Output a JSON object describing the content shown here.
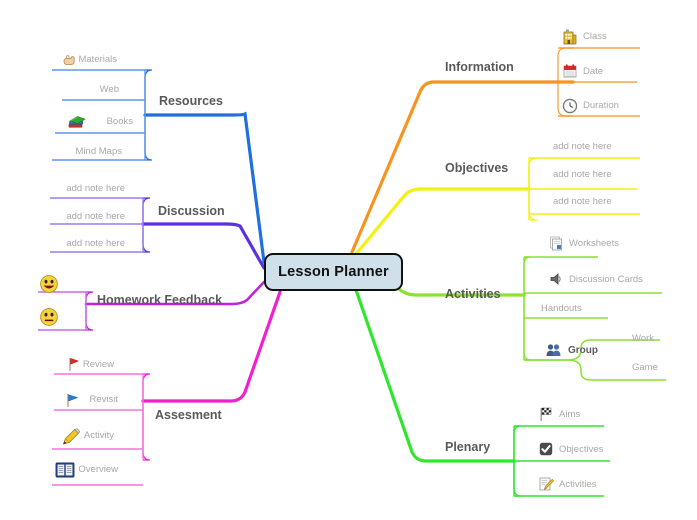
{
  "center": {
    "label": "Lesson Planner",
    "fill": "#cfe0ea",
    "stroke": "#111111"
  },
  "branches": [
    {
      "id": "information",
      "label": "Information",
      "color": "#f7941e",
      "side": "right",
      "children": [
        {
          "label": "Class",
          "icon": "building-icon"
        },
        {
          "label": "Date",
          "icon": "calendar-icon"
        },
        {
          "label": "Duration",
          "icon": "clock-icon"
        }
      ]
    },
    {
      "id": "objectives",
      "label": "Objectives",
      "color": "#f2f20d",
      "side": "right",
      "children": [
        {
          "label": "add note here",
          "icon": ""
        },
        {
          "label": "add note here",
          "icon": ""
        },
        {
          "label": "add note here",
          "icon": ""
        }
      ]
    },
    {
      "id": "activities",
      "label": "Activities",
      "color": "#8ae234",
      "side": "right",
      "children": [
        {
          "label": "Worksheets",
          "icon": "worksheet-icon"
        },
        {
          "label": "Discussion Cards",
          "icon": "speaker-icon"
        },
        {
          "label": "Handouts",
          "icon": ""
        },
        {
          "label": "Group",
          "icon": "people-icon"
        }
      ],
      "grandchildren": [
        {
          "label": "Work",
          "icon": ""
        },
        {
          "label": "Game",
          "icon": ""
        }
      ]
    },
    {
      "id": "plenary",
      "label": "Plenary",
      "color": "#2ee62e",
      "side": "right",
      "children": [
        {
          "label": "Aims",
          "icon": "checkered-flag-icon"
        },
        {
          "label": "Objectives",
          "icon": "checkbox-icon"
        },
        {
          "label": "Activities",
          "icon": "note-pencil-icon"
        }
      ]
    },
    {
      "id": "resources",
      "label": "Resources",
      "color": "#1f6fe0",
      "side": "left",
      "children": [
        {
          "label": "Materials",
          "icon": "hand-icon"
        },
        {
          "label": "Web",
          "icon": ""
        },
        {
          "label": "Books",
          "icon": "books-icon"
        },
        {
          "label": "Mind Maps",
          "icon": ""
        }
      ]
    },
    {
      "id": "discussion",
      "label": "Discussion",
      "color": "#5b32e0",
      "side": "left",
      "children": [
        {
          "label": "add note here",
          "icon": ""
        },
        {
          "label": "add note here",
          "icon": ""
        },
        {
          "label": "add note here",
          "icon": ""
        }
      ]
    },
    {
      "id": "homework-feedback",
      "label": "Homework Feedback",
      "color": "#c21fe0",
      "side": "left",
      "children": [
        {
          "label": "",
          "icon": "smiley-happy-icon"
        },
        {
          "label": "",
          "icon": "smiley-neutral-icon"
        }
      ]
    },
    {
      "id": "assesment",
      "label": "Assesment",
      "color": "#f21fd0",
      "side": "left",
      "children": [
        {
          "label": "Review",
          "icon": "red-flag-icon"
        },
        {
          "label": "Revisit",
          "icon": "blue-flag-icon"
        },
        {
          "label": "Activity",
          "icon": "pencil-icon"
        },
        {
          "label": "Overview",
          "icon": "open-book-icon"
        }
      ]
    }
  ]
}
